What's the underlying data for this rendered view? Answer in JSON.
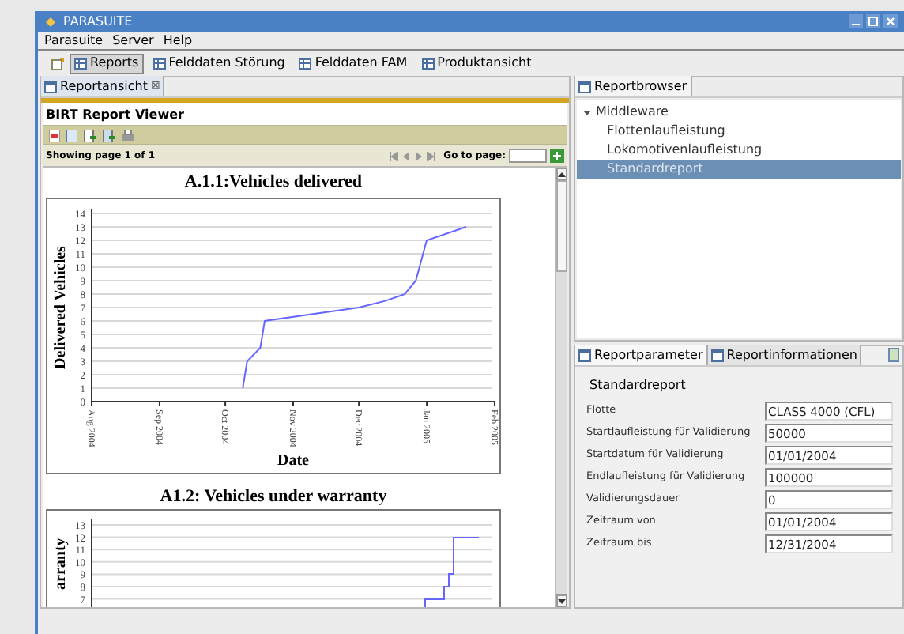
{
  "window": {
    "title": "PARASUITE"
  },
  "menu": [
    "Parasuite",
    "Server",
    "Help"
  ],
  "perspectives": [
    {
      "label": "Reports",
      "selected": true
    },
    {
      "label": "Felddaten Störung",
      "selected": false
    },
    {
      "label": "Felddaten FAM",
      "selected": false
    },
    {
      "label": "Produktansicht",
      "selected": false
    }
  ],
  "report_view": {
    "tab": "Reportansicht",
    "close": "⊠",
    "viewer_title": "BIRT Report Viewer",
    "page_info": {
      "showing": "Showing page",
      "page": "1",
      "of": "of",
      "total": "1"
    },
    "goto_label": "Go to page:",
    "chart_1": {
      "chart_data": {
        "type": "line",
        "title": "A.1.1:Vehicles delivered",
        "xlabel": "Date",
        "ylabel": "Delivered Vehicles",
        "x": [
          "2004-10-09",
          "2004-10-11",
          "2004-10-17",
          "2004-10-19",
          "2004-12-01",
          "2004-12-13",
          "2004-12-22",
          "2004-12-27",
          "2005-01-01",
          "2005-01-19"
        ],
        "grid": true,
        "series": [
          {
            "color": "#6666ff",
            "values": [
              1,
              3,
              4,
              6,
              7,
              7.5,
              8,
              9,
              12,
              13
            ]
          }
        ],
        "xlim": [
          "2004-08-01",
          "2005-02-01"
        ],
        "ylim": [
          0,
          14
        ],
        "xticks": [
          {
            "value": "2004-08-01",
            "label": "Aug 2004"
          },
          {
            "value": "2004-09-01",
            "label": "Sep 2004"
          },
          {
            "value": "2004-10-01",
            "label": "Oct 2004"
          },
          {
            "value": "2004-11-01",
            "label": "Nov 2004"
          },
          {
            "value": "2004-12-01",
            "label": "Dec 2004"
          },
          {
            "value": "2005-01-01",
            "label": "Jan 2005"
          },
          {
            "value": "2005-02-01",
            "label": "Feb 2005"
          }
        ],
        "yticks": [
          0,
          1,
          2,
          3,
          4,
          5,
          6,
          7,
          8,
          9,
          10,
          11,
          12,
          13,
          14
        ]
      }
    },
    "chart_2": {
      "title": "A1.2: Vehicles under warranty",
      "ylabel": "arranty",
      "yticks": [
        "13",
        "12",
        "11",
        "10",
        "9",
        "8",
        "7"
      ]
    }
  },
  "reportbrowser": {
    "tab": "Reportbrowser",
    "tree": [
      {
        "label": "Middleware",
        "expanded": true,
        "selected": false,
        "children": [
          {
            "label": "Flottenlaufleistung",
            "selected": false
          },
          {
            "label": "Lokomotivenlaufleistung",
            "selected": false
          },
          {
            "label": "Standardreport",
            "selected": true
          }
        ]
      }
    ]
  },
  "parameters": {
    "tabs": [
      {
        "label": "Reportparameter",
        "selected": true
      },
      {
        "label": "Reportinformationen",
        "selected": false
      }
    ],
    "report_name": "Standardreport",
    "fields": [
      {
        "label": "Flotte",
        "value": "CLASS 4000 (CFL)"
      },
      {
        "label": "Startlaufleistung für Validierung",
        "value": "50000"
      },
      {
        "label": "Startdatum für Validierung",
        "value": "01/01/2004"
      },
      {
        "label": "Endlaufleistung für Validierung",
        "value": "100000"
      },
      {
        "label": "Validierungsdauer",
        "value": "0"
      },
      {
        "label": "Zeitraum von",
        "value": "01/01/2004"
      },
      {
        "label": "Zeitraum bis",
        "value": "12/31/2004"
      }
    ]
  }
}
